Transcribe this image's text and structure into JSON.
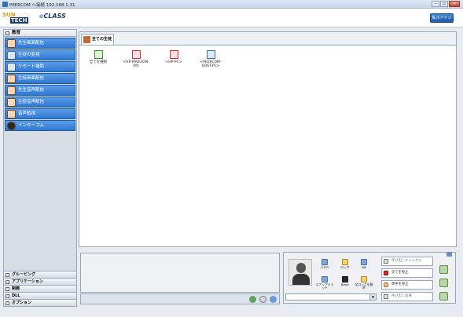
{
  "window": {
    "title": "PEERCOM へ接続 192.168.1.31",
    "buttons": [
      "‒",
      "▫",
      "✕"
    ]
  },
  "header": {
    "logo_sun": "SUN",
    "logo_tech": "TECH",
    "logo_class": "CLASS",
    "signin_label": "私ホアイン"
  },
  "sidebar": {
    "section_title": "教育",
    "items": [
      {
        "label": "先生画面配信",
        "icon": "teacher-icon"
      },
      {
        "label": "生徒の監視",
        "icon": "monitor-icon"
      },
      {
        "label": "リモート補助",
        "icon": "remote-icon"
      },
      {
        "label": "生徒画面配信",
        "icon": "student-screen-icon"
      },
      {
        "label": "先生音声配信",
        "icon": "teacher-audio-icon"
      },
      {
        "label": "生徒音声配信",
        "icon": "student-audio-icon"
      },
      {
        "label": "音声監視",
        "icon": "audio-monitor-icon"
      },
      {
        "label": "インターコム",
        "icon": "intercom-icon"
      }
    ],
    "bottom_items": [
      {
        "label": "グルーピング"
      },
      {
        "label": "アプリケーション"
      },
      {
        "label": "制御"
      },
      {
        "label": "DLL"
      },
      {
        "label": "オプション"
      }
    ]
  },
  "main": {
    "tab_label": "全ての生徒",
    "students": [
      {
        "label": "全てを選択",
        "state": "select-all"
      },
      {
        "label": "<HP-PAVILION-(M)",
        "state": "offline"
      },
      {
        "label": "<HP-PC>",
        "state": "offline"
      },
      {
        "label": "<PEERCOM-VOST-PC>",
        "state": "online"
      }
    ]
  },
  "controls": {
    "buttons": [
      {
        "label": "パネル"
      },
      {
        "label": "ロック"
      },
      {
        "label": "NB"
      },
      {
        "label": "スナップショット"
      },
      {
        "label": "Black"
      },
      {
        "label": "全ロックを解除"
      }
    ],
    "right_buttons": [
      {
        "label": "呼び出しキャンセル",
        "state": "disabled"
      },
      {
        "label": "全てを停止",
        "state": "enabled"
      },
      {
        "label": "挙手を停止",
        "state": "enabled"
      },
      {
        "label": "呼び出し返事",
        "state": "disabled"
      }
    ],
    "dropdown_value": ""
  },
  "colors": {
    "accent": "#2f78d2",
    "brand_navy": "#1d3a6b",
    "brand_orange": "#e69b12"
  }
}
